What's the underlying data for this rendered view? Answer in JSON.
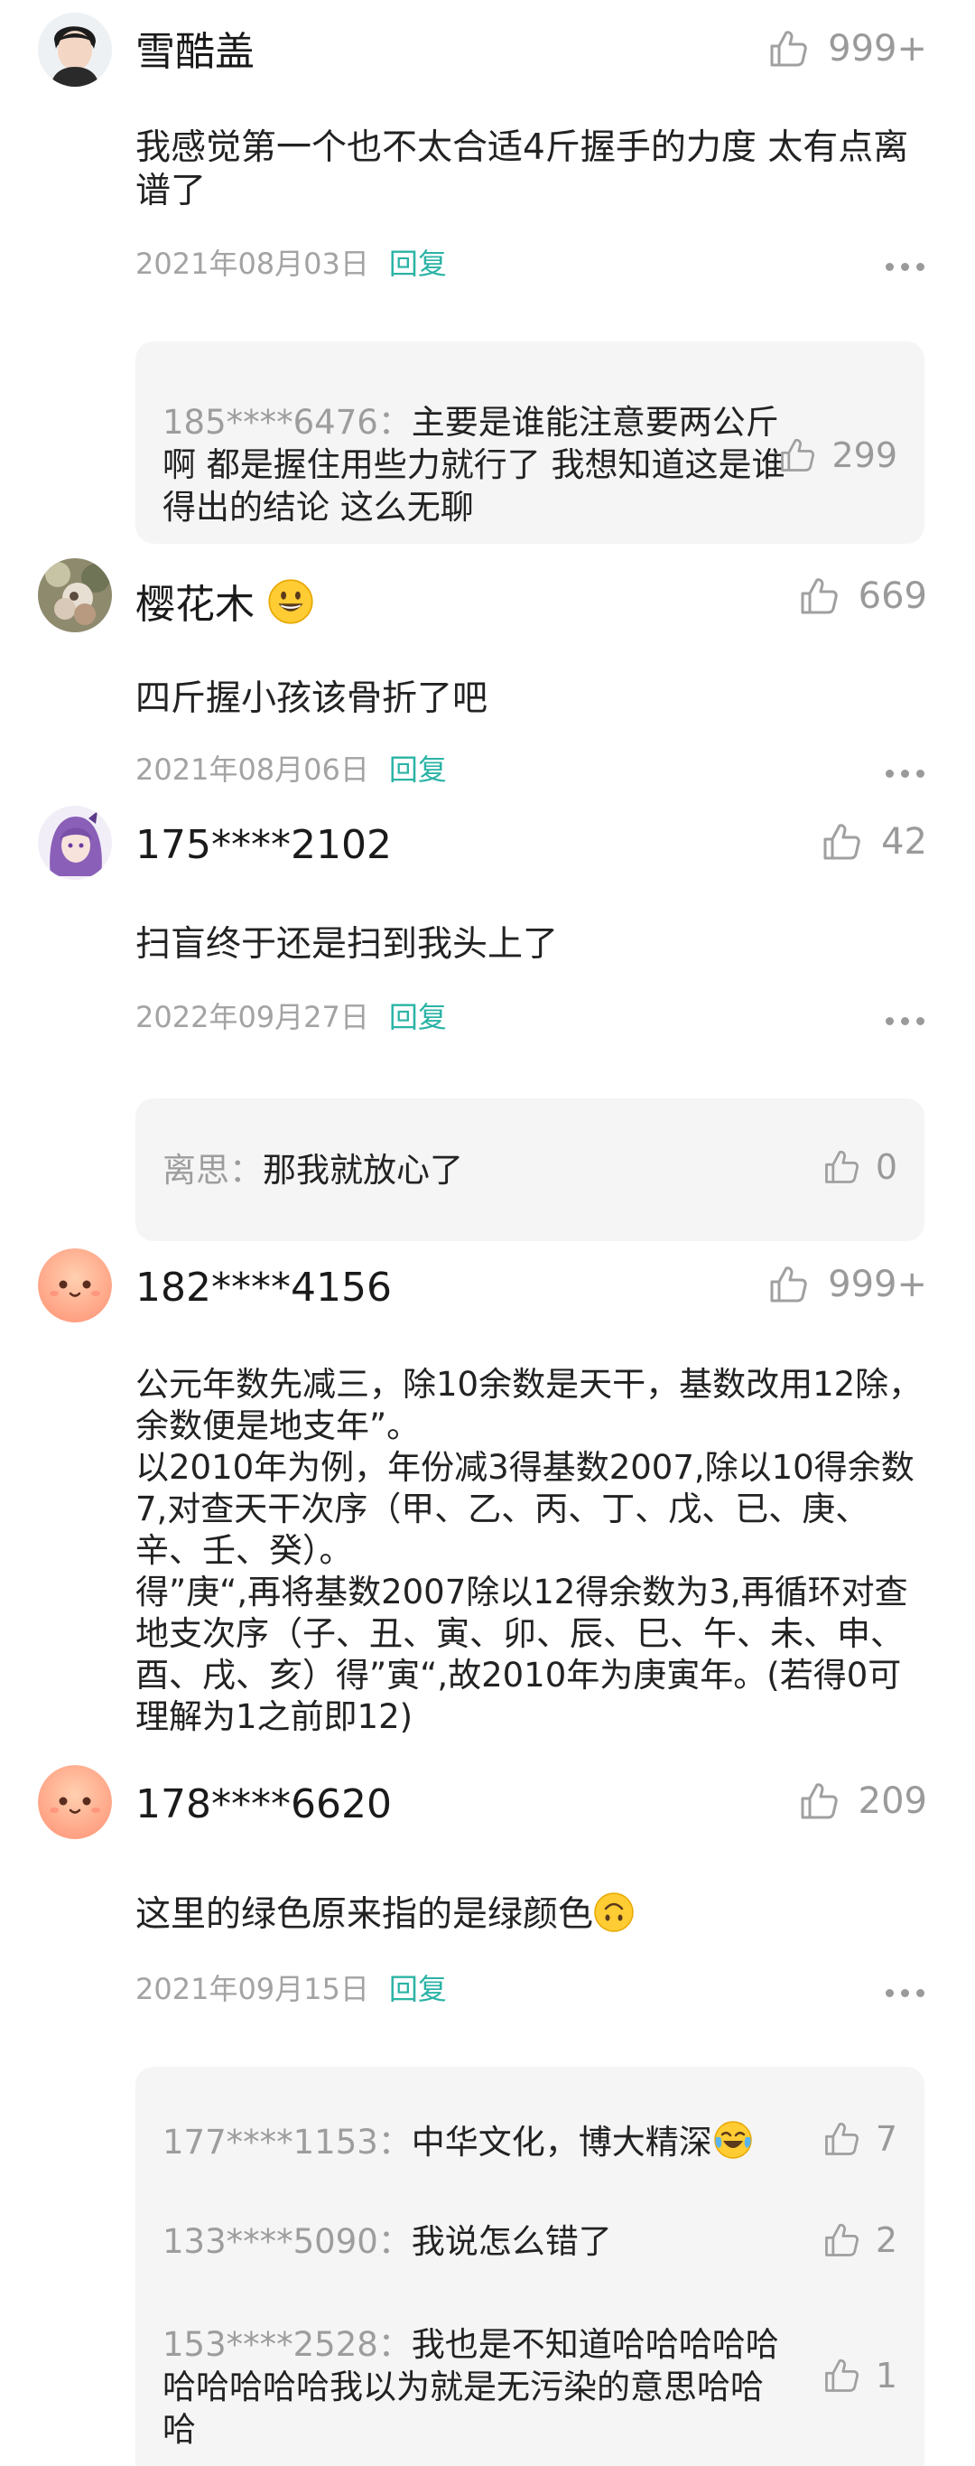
{
  "colors": {
    "reply_link": "#2bb3a5",
    "muted": "#9a9a9a",
    "reply_bg": "#f5f5f5"
  },
  "comments": [
    {
      "username": "雪酷盖",
      "likes": "999+",
      "text": "我感觉第一个也不太合适4斤握手的力度 太有点离谱了",
      "date": "2021年08月03日",
      "reply_label": "回复",
      "replies": [
        {
          "name": "185****6476：",
          "text": "主要是谁能注意要两公斤啊 都是握住用些力就行了 我想知道这是谁得出的结论 这么无聊",
          "likes": "299"
        }
      ]
    },
    {
      "username": "樱花木",
      "username_emoji": "grinning-face",
      "likes": "669",
      "text": "四斤握小孩该骨折了吧",
      "date": "2021年08月06日",
      "reply_label": "回复"
    },
    {
      "username": "175****2102",
      "likes": "42",
      "text": "扫盲终于还是扫到我头上了",
      "date": "2022年09月27日",
      "reply_label": "回复",
      "replies": [
        {
          "name": "离思：",
          "text": "那我就放心了",
          "likes": "0"
        }
      ]
    },
    {
      "username": "182****4156",
      "likes": "999+",
      "text": "公元年数先减三，除10余数是天干，基数改用12除，余数便是地支年”。\n以2010年为例，年份减3得基数2007,除以10得余数7,对查天干次序（甲、乙、丙、丁、戊、已、庚、辛、壬、癸）。\n得”庚“,再将基数2007除以12得余数为3,再循环对查地支次序（子、丑、寅、卯、辰、巳、午、未、申、酉、戌、亥）得”寅“,故2010年为庚寅年。(若得0可理解为1之前即12)"
    },
    {
      "username": "178****6620",
      "likes": "209",
      "text": "这里的绿色原来指的是绿颜色",
      "text_emoji": "upside-down-face",
      "date": "2021年09月15日",
      "reply_label": "回复",
      "replies": [
        {
          "name": "177****1153：",
          "text": "中华文化，博大精深",
          "emoji": "tears-of-joy-face",
          "likes": "7"
        },
        {
          "name": "133****5090：",
          "text": "我说怎么错了",
          "likes": "2"
        },
        {
          "name": "153****2528：",
          "text": "我也是不知道哈哈哈哈哈哈哈哈哈哈我以为就是无污染的意思哈哈哈",
          "likes": "1"
        }
      ]
    }
  ]
}
